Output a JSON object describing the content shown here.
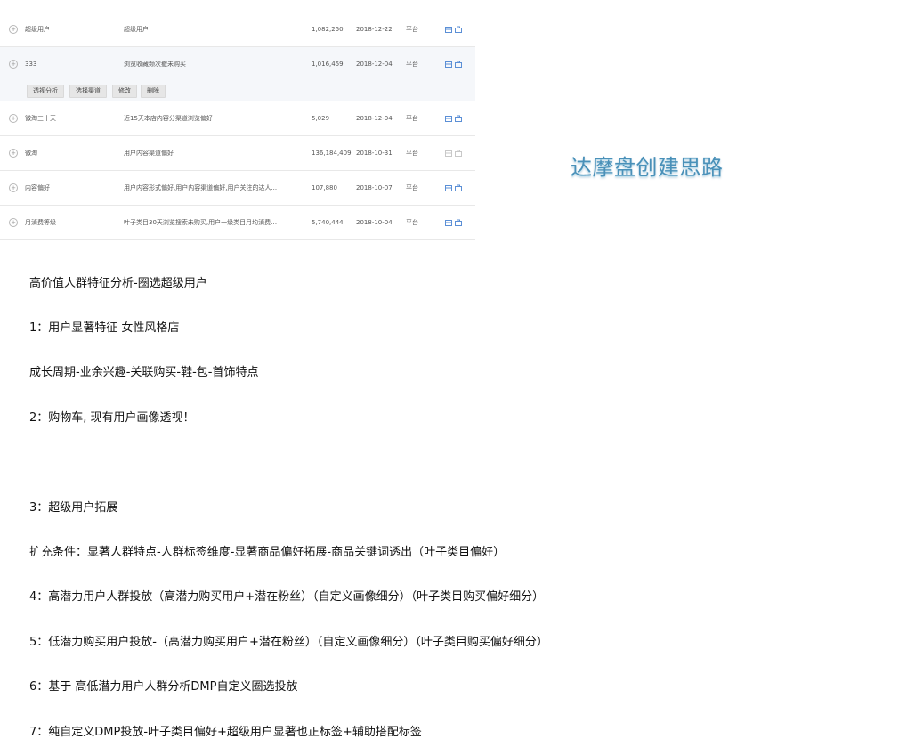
{
  "table": {
    "rows": [
      {
        "name": "超级用户",
        "desc": "超级用户",
        "count": "1,082,250",
        "date": "2018-12-22",
        "platform": "平台",
        "actions_disabled": false
      },
      {
        "name": "333",
        "desc": "浏览收藏频次撤未购买",
        "count": "1,016,459",
        "date": "2018-12-04",
        "platform": "平台",
        "actions_disabled": false
      },
      {
        "name": "微淘三十天",
        "desc": "近15天本店内容分渠道浏览偏好",
        "count": "5,029",
        "date": "2018-12-04",
        "platform": "平台",
        "actions_disabled": false
      },
      {
        "name": "微淘",
        "desc": "用户内容渠道偏好",
        "count": "136,184,409",
        "date": "2018-10-31",
        "platform": "平台",
        "actions_disabled": true
      },
      {
        "name": "内容偏好",
        "desc": "用户内容形式偏好,用户内容渠道偏好,用户关注的达人...",
        "count": "107,880",
        "date": "2018-10-07",
        "platform": "平台",
        "actions_disabled": false
      },
      {
        "name": "月消费等级",
        "desc": "叶子类目30天浏览搜索未购买,用户一级类目月均消费等...",
        "count": "5,740,444",
        "date": "2018-10-04",
        "platform": "平台",
        "actions_disabled": false
      }
    ],
    "row_actions": {
      "perspective": "透视分析",
      "select_channel": "选择渠道",
      "edit": "修改",
      "delete": "删除"
    }
  },
  "title": "达摩盘创建思路",
  "notes": [
    "高价值人群特征分析-圈选超级用户",
    "1：用户显著特征 女性风格店",
    "成长周期-业余兴趣-关联购买-鞋-包-首饰特点",
    "2：购物车, 现有用户画像透视！",
    "",
    "3：超级用户拓展",
    "扩充条件：显著人群特点-人群标签维度-显著商品偏好拓展-商品关键词透出（叶子类目偏好）",
    "4：高潜力用户人群投放（高潜力购买用户+潜在粉丝）（自定义画像细分）（叶子类目购买偏好细分）",
    "5：低潜力购买用户投放-（高潜力购买用户+潜在粉丝）（自定义画像细分）（叶子类目购买偏好细分）",
    "6：基于 高低潜力用户人群分析DMP自定义圈选投放",
    "7：纯自定义DMP投放-叶子类目偏好+超级用户显著也正标签+辅助搭配标签"
  ],
  "colors": {
    "title": "#4a90b8",
    "action_icon": "#5b8fd6",
    "action_icon_disabled": "#c8c8c8",
    "expanded_bg": "#f5f7fa"
  }
}
